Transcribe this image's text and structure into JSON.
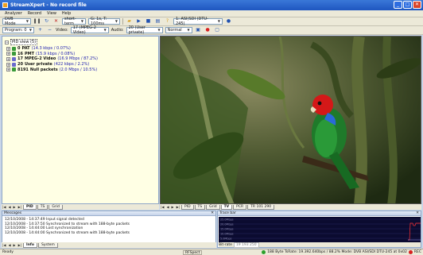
{
  "window": {
    "title": "StreamXpert - No record file"
  },
  "menu": [
    "Analyzer",
    "Record",
    "View",
    "Help"
  ],
  "toolbar1": {
    "mode": "DVB Mode",
    "short_term": "short-term",
    "timing": "G: 1s, T: 100ms",
    "device": "1: ASI(SDI (DTU-245)"
  },
  "toolbar2": {
    "program": "Program: 0",
    "video_label": "Video:",
    "video_value": "17 (MPEG-2 Video)",
    "audio_label": "Audio:",
    "audio_value": "20 (User private)",
    "normal": "Normal"
  },
  "tree": {
    "root": "PID view (5)",
    "items": [
      {
        "pid": "0",
        "name": "PAT",
        "detail": "(14.3 kbps / 0.07%)"
      },
      {
        "pid": "16",
        "name": "PMT",
        "detail": "(15.9 kbps / 0.08%)"
      },
      {
        "pid": "17",
        "name": "MPEG-2 Video",
        "detail": "(16.9 Mbps / 87.2%)"
      },
      {
        "pid": "20",
        "name": "User private",
        "detail": "(422 kbps / 2.2%)"
      },
      {
        "pid": "8191",
        "name": "Null packets",
        "detail": "(2.0 Mbps / 10.5%)"
      }
    ]
  },
  "tabs_left": [
    "PID",
    "TS",
    "Grid"
  ],
  "tabs_video": [
    "PID",
    "TS",
    "Grid",
    "TV",
    "PCR",
    "TR 101 290"
  ],
  "messages": {
    "title": "Messages",
    "lines": [
      "12/10/2008 - 14:37:49 Input signal detected",
      "12/10/2008 - 14:37:50 Synchronized to stream with 188-byte packets",
      "12/10/2008 - 14:44:00 Lost synchronization",
      "12/10/2008 - 14:44:00 Synchronized to stream with 188-byte packets"
    ]
  },
  "tabs_msg": [
    "Info",
    "System"
  ],
  "trace": {
    "title": "Trace bar",
    "y_ticks": [
      "25.0Mbps",
      "20.0Mbps",
      "15.0Mbps",
      "10.0Mbps",
      "5.0Mbps"
    ],
    "bitrate_label": "Bit-rate",
    "bitrate_value": "19 193 250"
  },
  "status": {
    "left": "Ready",
    "mid": "RFSpect",
    "right": "188 Byte  TsRate: 19.392.640bps / 88.2%  Mode: DVB  ASI/SDI  DTU-245 at 0x02",
    "rec": "REC"
  },
  "colors": {
    "title_bar": "#1f56c0",
    "trace_line": "#ff3030",
    "video_bg": "#2b3a1c"
  }
}
